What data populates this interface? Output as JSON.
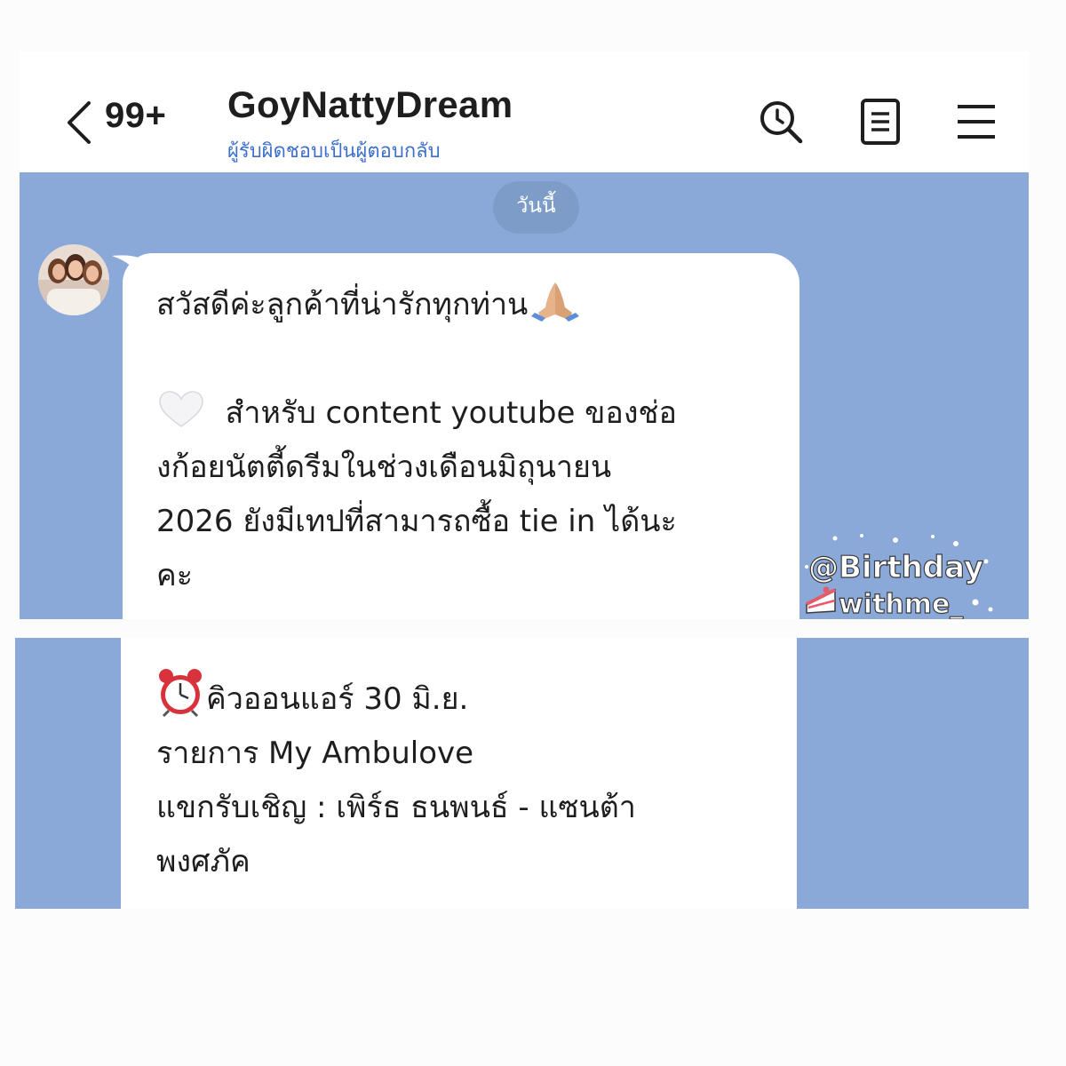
{
  "header": {
    "unread_count": "99+",
    "title": "GoyNattyDream",
    "subtitle": "ผู้รับผิดชอบเป็นผู้ตอบกลับ"
  },
  "chat": {
    "date_label": "วันนี้",
    "message_top_lines": [
      "สวัสดีค่ะลูกค้าที่น่ารักทุกท่าน",
      "",
      "สำหรับ content youtube ของช่อ",
      "งก้อยนัตตี้ดรีมในช่วงเดือนมิถุนายน",
      "2026 ยังมีเทปที่สามารถซื้อ tie in ได้นะ",
      "คะ"
    ],
    "message_bottom_lines": [
      "คิวออนแอร์ 30 มิ.ย.",
      "รายการ My Ambulove",
      "แขกรับเชิญ : เพิร์ธ ธนพนธ์ - แซนต้า",
      "พงศภัค"
    ]
  },
  "watermark": {
    "line1": "@Birthday",
    "line2": "withme_"
  },
  "icons": {
    "back": "chevron-left-icon",
    "search": "search-icon",
    "notes": "notes-icon",
    "menu": "hamburger-menu-icon",
    "pray": "folded-hands-emoji",
    "heart": "white-heart-emoji",
    "clock": "alarm-clock-emoji",
    "cake": "cake-slice-icon"
  },
  "colors": {
    "chat_background": "#8aa9d8",
    "date_chip": "#7d9cc8",
    "subtitle_blue": "#3d6fd0",
    "bubble": "#ffffff"
  }
}
